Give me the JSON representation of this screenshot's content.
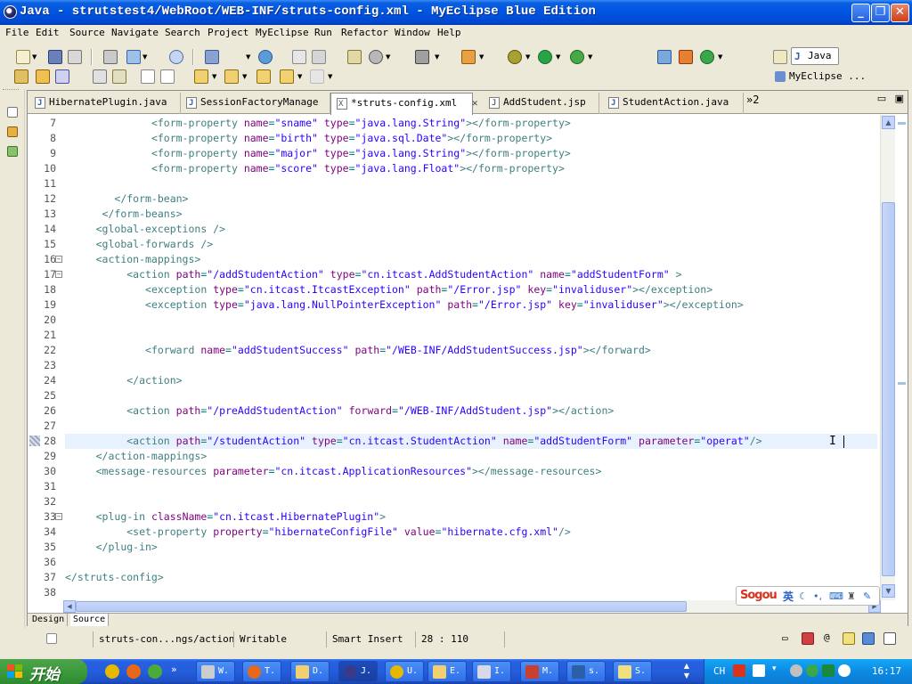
{
  "window": {
    "title": "Java - strutstest4/WebRoot/WEB-INF/struts-config.xml - MyEclipse Blue Edition",
    "minimize": "_",
    "maximize": "❐",
    "close": "✕"
  },
  "menu": [
    "File",
    "Edit",
    "Source",
    "Navigate",
    "Search",
    "Project",
    "MyEclipse",
    "Run",
    "Refactor",
    "Window",
    "Help"
  ],
  "perspectives": {
    "java": "Java",
    "myeclipse": "MyEclipse ..."
  },
  "tabs": [
    {
      "label": "HibernatePlugin.java",
      "kind": "java"
    },
    {
      "label": "SessionFactoryManage",
      "kind": "java"
    },
    {
      "label": "*struts-config.xml",
      "kind": "xml",
      "active": true
    },
    {
      "label": "AddStudent.jsp",
      "kind": "jsp"
    },
    {
      "label": "StudentAction.java",
      "kind": "java"
    }
  ],
  "tabs_overflow": "»2",
  "editor": {
    "lines": [
      {
        "n": "7",
        "html": "              <span class=\"el\">&lt;form-property</span> <span class=\"an\">name</span>=<span class=\"av\">\"sname\"</span> <span class=\"an\">type</span>=<span class=\"av\">\"java.lang.String\"</span><span class=\"el\">&gt;&lt;/form-property&gt;</span>"
      },
      {
        "n": "8",
        "html": "              <span class=\"el\">&lt;form-property</span> <span class=\"an\">name</span>=<span class=\"av\">\"birth\"</span> <span class=\"an\">type</span>=<span class=\"av\">\"java.sql.Date\"</span><span class=\"el\">&gt;&lt;/form-property&gt;</span>"
      },
      {
        "n": "9",
        "html": "              <span class=\"el\">&lt;form-property</span> <span class=\"an\">name</span>=<span class=\"av\">\"major\"</span> <span class=\"an\">type</span>=<span class=\"av\">\"java.lang.String\"</span><span class=\"el\">&gt;&lt;/form-property&gt;</span>"
      },
      {
        "n": "10",
        "html": "              <span class=\"el\">&lt;form-property</span> <span class=\"an\">name</span>=<span class=\"av\">\"score\"</span> <span class=\"an\">type</span>=<span class=\"av\">\"java.lang.Float\"</span><span class=\"el\">&gt;&lt;/form-property&gt;</span>"
      },
      {
        "n": "11",
        "html": ""
      },
      {
        "n": "12",
        "html": "        <span class=\"el\">&lt;/form-bean&gt;</span>"
      },
      {
        "n": "13",
        "html": "      <span class=\"el\">&lt;/form-beans&gt;</span>"
      },
      {
        "n": "14",
        "html": "     <span class=\"el\">&lt;global-exceptions /&gt;</span>"
      },
      {
        "n": "15",
        "html": "     <span class=\"el\">&lt;global-forwards /&gt;</span>"
      },
      {
        "n": "16",
        "fold": true,
        "html": "     <span class=\"el\">&lt;action-mappings&gt;</span>"
      },
      {
        "n": "17",
        "fold": true,
        "html": "          <span class=\"el\">&lt;action</span> <span class=\"an\">path</span>=<span class=\"av\">\"/addStudentAction\"</span> <span class=\"an\">type</span>=<span class=\"av\">\"cn.itcast.AddStudentAction\"</span> <span class=\"an\">name</span>=<span class=\"av\">\"addStudentForm\"</span> <span class=\"el\">&gt;</span>"
      },
      {
        "n": "18",
        "html": "             <span class=\"el\">&lt;exception</span> <span class=\"an\">type</span>=<span class=\"av\">\"cn.itcast.ItcastException\"</span> <span class=\"an\">path</span>=<span class=\"av\">\"/Error.jsp\"</span> <span class=\"an\">key</span>=<span class=\"av\">\"invaliduser\"</span><span class=\"el\">&gt;&lt;/exception&gt;</span>"
      },
      {
        "n": "19",
        "html": "             <span class=\"el\">&lt;exception</span> <span class=\"an\">type</span>=<span class=\"av\">\"java.lang.NullPointerException\"</span> <span class=\"an\">path</span>=<span class=\"av\">\"/Error.jsp\"</span> <span class=\"an\">key</span>=<span class=\"av\">\"invaliduser\"</span><span class=\"el\">&gt;&lt;/exception&gt;</span>"
      },
      {
        "n": "20",
        "html": ""
      },
      {
        "n": "21",
        "html": ""
      },
      {
        "n": "22",
        "html": "             <span class=\"el\">&lt;forward</span> <span class=\"an\">name</span>=<span class=\"av\">\"addStudentSuccess\"</span> <span class=\"an\">path</span>=<span class=\"av\">\"/WEB-INF/AddStudentSuccess.jsp\"</span><span class=\"el\">&gt;&lt;/forward&gt;</span>"
      },
      {
        "n": "23",
        "html": ""
      },
      {
        "n": "24",
        "html": "          <span class=\"el\">&lt;/action&gt;</span>"
      },
      {
        "n": "25",
        "html": ""
      },
      {
        "n": "26",
        "html": "          <span class=\"el\">&lt;action</span> <span class=\"an\">path</span>=<span class=\"av\">\"/preAddStudentAction\"</span> <span class=\"an\">forward</span>=<span class=\"av\">\"/WEB-INF/AddStudent.jsp\"</span><span class=\"el\">&gt;&lt;/action&gt;</span>"
      },
      {
        "n": "27",
        "html": ""
      },
      {
        "n": "28",
        "cur": true,
        "html": "          <span class=\"el\">&lt;action</span> <span class=\"an\">path</span>=<span class=\"av\">\"/studentAction\"</span> <span class=\"an\">type</span>=<span class=\"av\">\"cn.itcast.StudentAction\"</span> <span class=\"an\">name</span>=<span class=\"av\">\"addStudentForm\"</span> <span class=\"an\">parameter</span>=<span class=\"av\">\"operat\"</span><span class=\"el\">/&gt;</span>"
      },
      {
        "n": "29",
        "html": "     <span class=\"el\">&lt;/action-mappings&gt;</span>"
      },
      {
        "n": "30",
        "html": "     <span class=\"el\">&lt;message-resources</span> <span class=\"an\">parameter</span>=<span class=\"av\">\"cn.itcast.ApplicationResources\"</span><span class=\"el\">&gt;&lt;/message-resources&gt;</span>"
      },
      {
        "n": "31",
        "html": ""
      },
      {
        "n": "32",
        "html": ""
      },
      {
        "n": "33",
        "fold": true,
        "html": "     <span class=\"el\">&lt;plug-in</span> <span class=\"an\">className</span>=<span class=\"av\">\"cn.itcast.HibernatePlugin\"</span><span class=\"el\">&gt;</span>"
      },
      {
        "n": "34",
        "html": "          <span class=\"el\">&lt;set-property</span> <span class=\"an\">property</span>=<span class=\"av\">\"hibernateConfigFile\"</span> <span class=\"an\">value</span>=<span class=\"av\">\"hibernate.cfg.xml\"</span><span class=\"el\">/&gt;</span>"
      },
      {
        "n": "35",
        "html": "     <span class=\"el\">&lt;/plug-in&gt;</span>"
      },
      {
        "n": "36",
        "html": ""
      },
      {
        "n": "37",
        "html": "<span class=\"el\">&lt;/struts-config&gt;</span>"
      },
      {
        "n": "38",
        "html": ""
      }
    ]
  },
  "view_tabs": {
    "design": "Design",
    "source": "Source"
  },
  "ime": {
    "brand": "Sogou",
    "mode": "英"
  },
  "status": {
    "path": "struts-con...ngs/action",
    "writable": "Writable",
    "insert": "Smart Insert",
    "position": "28 : 110"
  },
  "taskbar": {
    "start": "开始",
    "buttons": [
      "W.",
      "T.",
      "D.",
      "J.",
      "U.",
      "E.",
      "I.",
      "M.",
      "s.",
      "S."
    ],
    "tray_lang": "CH",
    "clock": "16:17"
  },
  "colors": {
    "xml_tag": "#3f7f7f",
    "xml_attr": "#7f007f",
    "xml_value": "#2a00ff",
    "current_line": "#e8f2fe"
  }
}
